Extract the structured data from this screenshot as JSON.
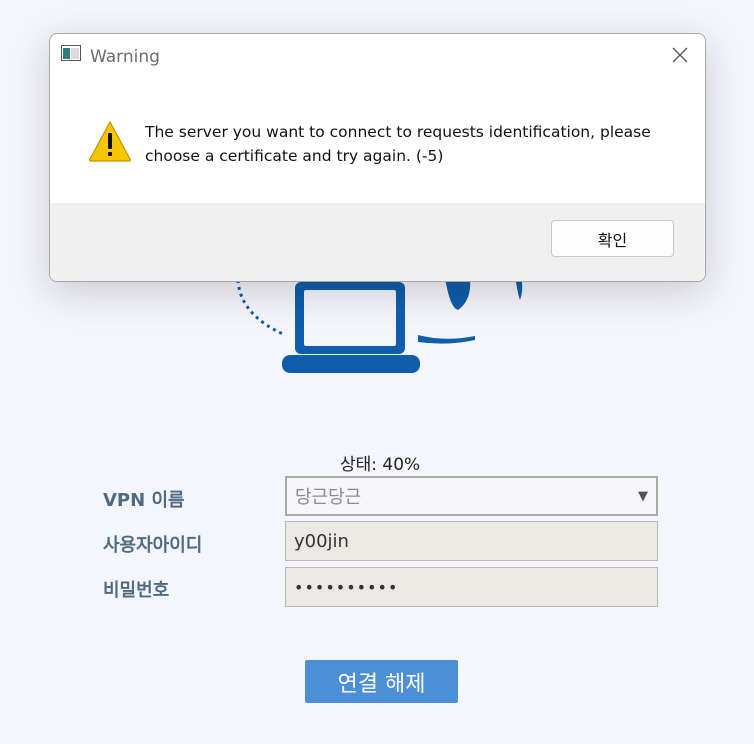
{
  "dialog": {
    "title": "Warning",
    "message": "The server you want to connect to requests identification, please choose a certificate and try again. (-5)",
    "ok_label": "확인",
    "icons": {
      "app": "window-app-icon",
      "close": "close-icon",
      "warning": "warning-icon"
    }
  },
  "status": {
    "text": "상태: 40%"
  },
  "form": {
    "vpn_name_label": "VPN 이름",
    "vpn_name_value": "당근당근",
    "user_id_label": "사용자아이디",
    "user_id_value": "y00jin",
    "password_label": "비밀번호",
    "password_value": "••••••••••"
  },
  "actions": {
    "disconnect_label": "연결 해제"
  },
  "colors": {
    "accent": "#4a8fd8",
    "illustration": "#0f5eab",
    "label": "#4f6a83"
  }
}
